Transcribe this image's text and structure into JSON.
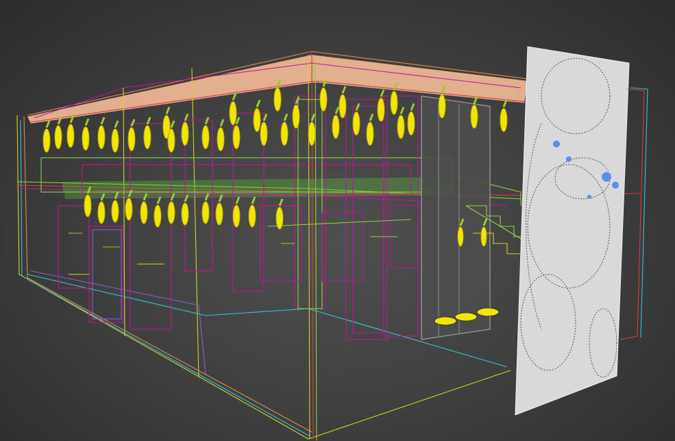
{
  "viewport": {
    "mode": "wireframe-perspective",
    "background": "#414141"
  },
  "colors": {
    "ceiling_fill": "#f0b896",
    "pendant": "#f2e600",
    "pendant_cap": "#9acd32",
    "panel_fill": "#d9d9d9",
    "dark_panel": "#4a4a4a",
    "wire_magenta": "#c0169a",
    "wire_green": "#8ed63a",
    "wire_yellow": "#d9d22a",
    "wire_orange": "#e38c4a",
    "wire_cyan": "#34c4d6",
    "wire_purple": "#8a5ad6",
    "wire_red": "#d63c3c",
    "floral_blue": "#5b8ee8"
  },
  "objects": [
    {
      "name": "ceiling-slab"
    },
    {
      "name": "pendant-light-array"
    },
    {
      "name": "mezzanine-floor"
    },
    {
      "name": "staircase"
    },
    {
      "name": "display-shelves"
    },
    {
      "name": "decorative-wall-panel"
    },
    {
      "name": "floor-plate"
    }
  ]
}
